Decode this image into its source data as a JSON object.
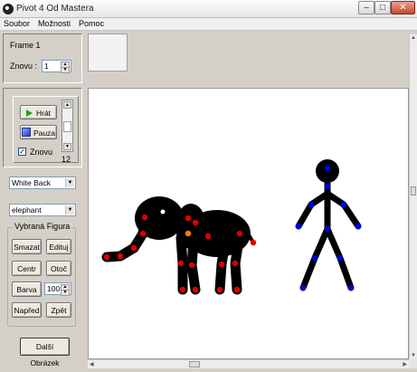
{
  "window": {
    "title": "Pivot 4 Od Mastera"
  },
  "menu": {
    "items": [
      "Soubor",
      "Možnosti",
      "Pomoc"
    ]
  },
  "frame_panel": {
    "frame_label": "Frame 1",
    "repeat_label": "Znovu :",
    "repeat_value": "1"
  },
  "playback": {
    "play_label": "Hrát",
    "pause_label": "Pauza",
    "loop_label": "Znovu",
    "loop_checked": true,
    "speed_value": "12"
  },
  "background_select": {
    "value": "White Back"
  },
  "figure_select": {
    "value": "elephant"
  },
  "selected_figure": {
    "title": "Vybraná Figura",
    "delete_label": "Smazat",
    "edit_label": "Edituj",
    "center_label": "Centr",
    "rotate_label": "Otoč",
    "color_label": "Barva",
    "size_value": "100",
    "forward_label": "Napřed",
    "back_label": "Zpět"
  },
  "next_frame_label": "Další Obrázek",
  "colors": {
    "joint_red": "#e00000",
    "joint_blue": "#0000e0",
    "joint_orange": "#ff8000",
    "joint_white": "#ffffff"
  }
}
